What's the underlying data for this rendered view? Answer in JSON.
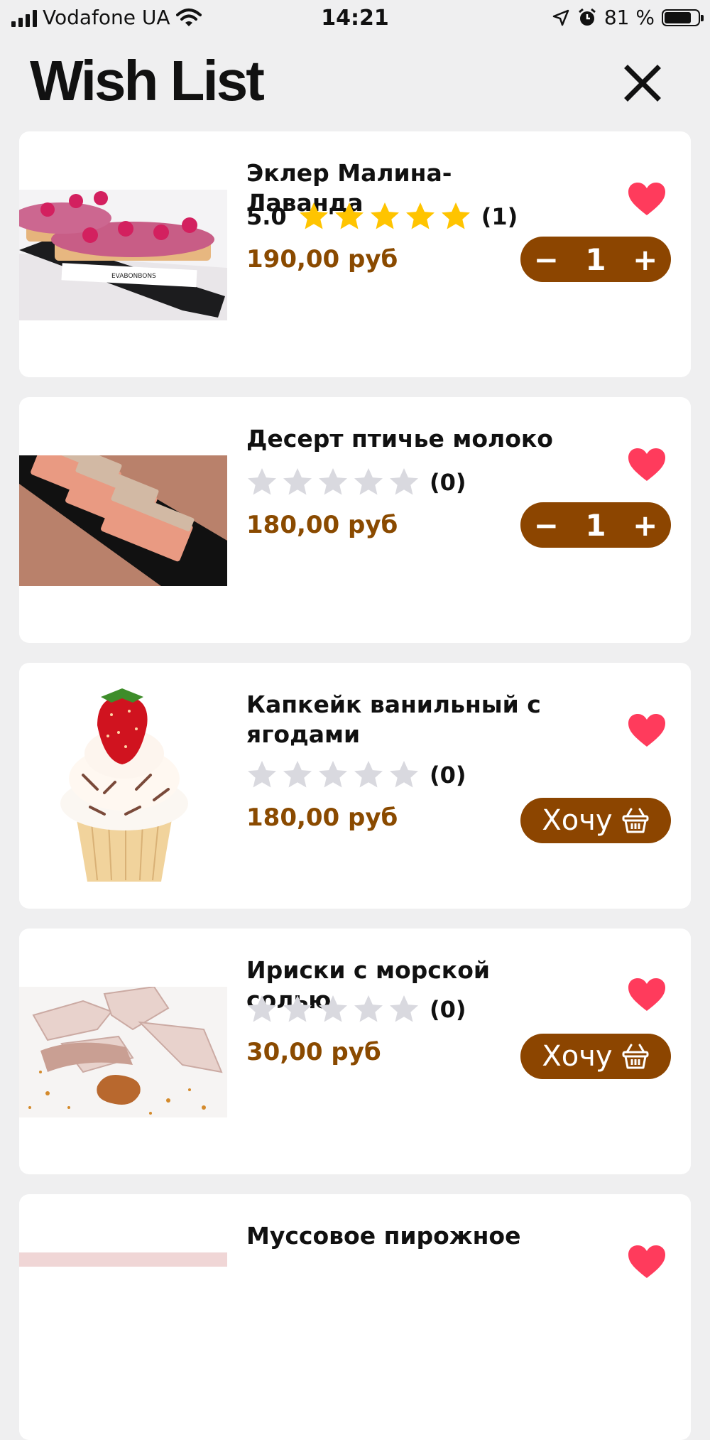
{
  "status_bar": {
    "carrier": "Vodafone UA",
    "time": "14:21",
    "battery_percent": "81 %",
    "battery_level": 0.81
  },
  "header": {
    "title": "Wish List",
    "close_icon": "close-icon"
  },
  "colors": {
    "accent": "#8c4500",
    "price": "#8a4a00",
    "heart": "#ff3b5c",
    "star_filled": "#ffc400",
    "star_empty": "#d9d9df",
    "background": "#efeff0"
  },
  "items": [
    {
      "name": "Эклер Малина-Лаванда",
      "score": "5.0",
      "stars": 5,
      "reviews": "(1)",
      "price": "190,00 руб",
      "quantity": "1",
      "favorite": true
    },
    {
      "name": "Десерт птичье молоко",
      "score": "",
      "stars": 0,
      "reviews": "(0)",
      "price": "180,00 руб",
      "quantity": "1",
      "favorite": true
    },
    {
      "name": "Капкейк ванильный с ягодами",
      "score": "",
      "stars": 0,
      "reviews": "(0)",
      "price": "180,00 руб",
      "button": "Хочу",
      "favorite": true
    },
    {
      "name": "Ириски с морской солью",
      "score": "",
      "stars": 0,
      "reviews": "(0)",
      "price": "30,00 руб",
      "button": "Хочу",
      "favorite": true
    },
    {
      "name": "Муссовое пирожное",
      "favorite": true
    }
  ],
  "stepper": {
    "minus": "−",
    "plus": "+"
  }
}
